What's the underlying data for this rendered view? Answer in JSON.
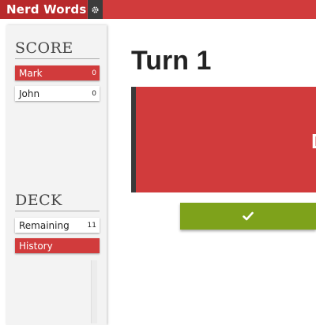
{
  "app": {
    "title": "Nerd Words"
  },
  "header": {
    "settings_icon": "gear-icon"
  },
  "sidebar": {
    "score": {
      "title": "SCORE",
      "players": [
        {
          "name": "Mark",
          "score": "0",
          "active": true
        },
        {
          "name": "John",
          "score": "0",
          "active": false
        }
      ]
    },
    "deck": {
      "title": "DECK",
      "remaining_label": "Remaining",
      "remaining_count": "11",
      "history_label": "History"
    }
  },
  "main": {
    "turn_title": "Turn 1",
    "current_word": "D",
    "correct_icon": "check-icon"
  },
  "colors": {
    "accent_red": "#d13b3c",
    "brand_red_dark": "#b8292b",
    "success_green": "#7ea21b"
  }
}
